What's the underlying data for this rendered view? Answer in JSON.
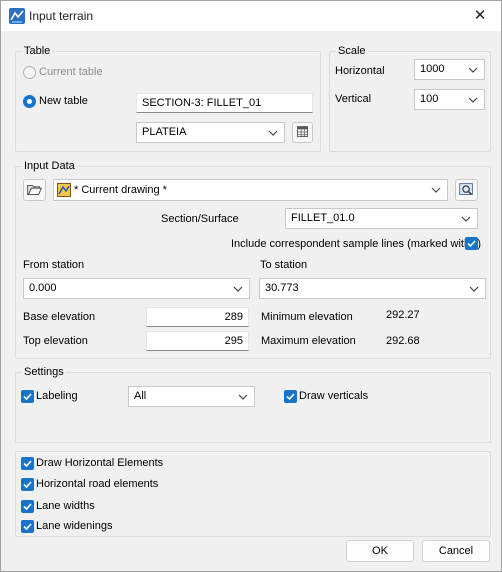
{
  "window": {
    "title": "Input terrain"
  },
  "table": {
    "group_title": "Table",
    "current_table_label": "Current table",
    "new_table_label": "New table",
    "new_table_name": "SECTION-3: FILLET_01",
    "table_style": "PLATEIA"
  },
  "scale": {
    "group_title": "Scale",
    "horizontal_label": "Horizontal",
    "horizontal_value": "1000",
    "vertical_label": "Vertical",
    "vertical_value": "100"
  },
  "input_data": {
    "group_title": "Input Data",
    "drawing": "* Current drawing *",
    "section_surface_label": "Section/Surface",
    "section_surface_value": "FILLET_01.0",
    "include_samples_label": "Include correspondent sample lines (marked with *)",
    "from_station_label": "From station",
    "from_station_value": "0.000",
    "to_station_label": "To station",
    "to_station_value": "30.773",
    "base_elevation_label": "Base elevation",
    "base_elevation_value": "289",
    "top_elevation_label": "Top elevation",
    "top_elevation_value": "295",
    "min_elevation_label": "Minimum elevation",
    "min_elevation_value": "292.27",
    "max_elevation_label": "Maximum elevation",
    "max_elevation_value": "292.68"
  },
  "settings": {
    "group_title": "Settings",
    "labeling_label": "Labeling",
    "labeling_value": "All",
    "draw_verticals_label": "Draw verticals"
  },
  "options": {
    "draw_horizontal_label": "Draw Horizontal Elements",
    "horizontal_road_label": "Horizontal road elements",
    "lane_widths_label": "Lane widths",
    "lane_widenings_label": "Lane widenings"
  },
  "buttons": {
    "ok": "OK",
    "cancel": "Cancel"
  },
  "colors": {
    "accent": "#1a73c8",
    "window_bg": "#f0f0f0"
  }
}
